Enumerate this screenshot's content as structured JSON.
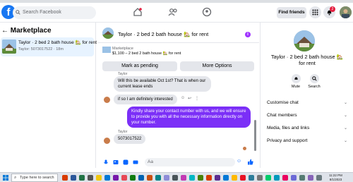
{
  "top": {
    "search_placeholder": "Search Facebook",
    "find_friends": "Find friends",
    "notif_count": "2"
  },
  "left": {
    "title": "Marketplace",
    "conversation": {
      "title": "Taylor · 2 bed 2 bath house 🏡 for rent",
      "subtitle": "Taylor: 5073017522 · 18m"
    }
  },
  "chat": {
    "title": "Taylor · 2 bed 2 bath house 🏡 for rent",
    "marketplace_label": "Marketplace",
    "listing": "$1,100 – 2 bed 2 bath house 🏡 for rent",
    "mark_pending": "Mark as pending",
    "more_options": "More Options",
    "messages": [
      {
        "sender": "Taylor",
        "text": "Will this be available Oct 1st? That is when our current lease ends",
        "dir": "in"
      },
      {
        "sender": "",
        "text": "if so I am definitely interested",
        "dir": "in"
      },
      {
        "sender": "",
        "text": "Kindly share your contact number with us, and we will ensure to provide you with all the necessary information directly on your number.",
        "dir": "out"
      },
      {
        "sender": "Taylor",
        "text": "5073017522",
        "dir": "in"
      }
    ],
    "input_placeholder": "Aa"
  },
  "right": {
    "name": "Taylor · 2 bed 2 bath house 🏡 for rent",
    "mute": "Mute",
    "search": "Search",
    "rows": [
      "Customise chat",
      "Chat members",
      "Media, files and links",
      "Privacy and support"
    ]
  },
  "taskbar": {
    "search_placeholder": "Type here to search",
    "time": "11:22 PM",
    "date": "8/1/2023"
  },
  "colors": {
    "accent": "#1877f2",
    "outgoing_bubble": "#7b2ff7",
    "incoming_bubble": "#e4e6eb"
  }
}
